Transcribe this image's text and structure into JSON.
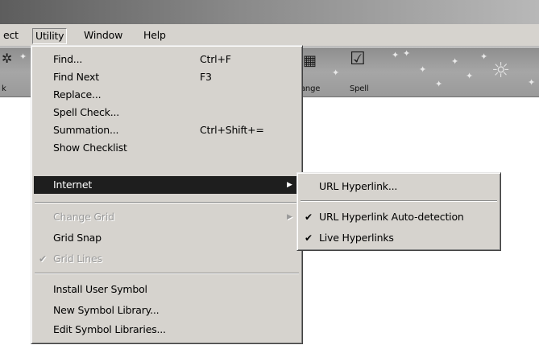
{
  "menubar": {
    "items": [
      "ect",
      "Utility",
      "Window",
      "Help"
    ]
  },
  "toolbar": {
    "left_label": "k",
    "change_label": "ange",
    "spell_label": "Spell"
  },
  "utility_menu": {
    "find": {
      "label": "Find...",
      "shortcut": "Ctrl+F"
    },
    "find_next": {
      "label": "Find Next",
      "shortcut": "F3"
    },
    "replace": {
      "label": "Replace..."
    },
    "spell_check": {
      "label": "Spell Check..."
    },
    "summation": {
      "label": "Summation...",
      "shortcut": "Ctrl+Shift+="
    },
    "show_checklist": {
      "label": "Show Checklist"
    },
    "internet": {
      "label": "Internet"
    },
    "change_grid": {
      "label": "Change Grid"
    },
    "grid_snap": {
      "label": "Grid Snap"
    },
    "grid_lines": {
      "label": "Grid Lines"
    },
    "install_user_symbol": {
      "label": "Install User Symbol"
    },
    "new_symbol_library": {
      "label": "New Symbol Library..."
    },
    "edit_symbol_libraries": {
      "label": "Edit Symbol Libraries..."
    }
  },
  "internet_submenu": {
    "url_hyperlink": {
      "label": "URL Hyperlink..."
    },
    "url_autodetect": {
      "label": "URL Hyperlink Auto-detection"
    },
    "live_hyperlinks": {
      "label": "Live Hyperlinks"
    }
  },
  "colors": {
    "menu_bg": "#d6d3ce",
    "highlight_bg": "#1e1e1e",
    "highlight_fg": "#ffffff",
    "disabled_fg": "#9a9a9a"
  }
}
